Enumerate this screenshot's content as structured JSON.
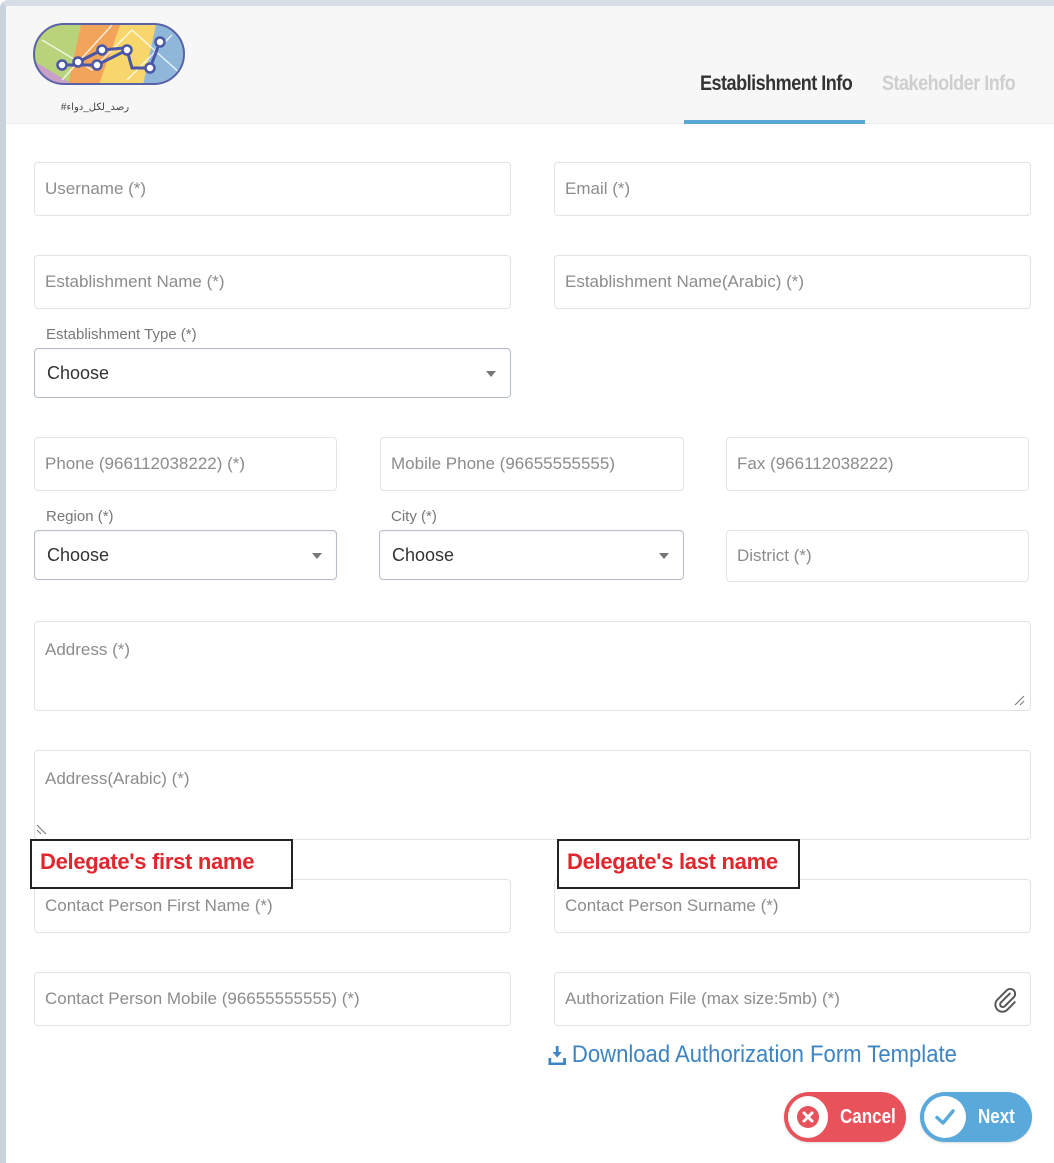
{
  "logo": {
    "caption": "#رصد_لكل_دواء"
  },
  "tabs": {
    "active": "Establishment Info",
    "inactive": "Stakeholder Info"
  },
  "form": {
    "username": "Username (*)",
    "email": "Email (*)",
    "establishment_name": "Establishment Name (*)",
    "establishment_name_arabic": "Establishment Name(Arabic) (*)",
    "establishment_type_label": "Establishment Type (*)",
    "establishment_type_value": "Choose",
    "phone": "Phone (966112038222) (*)",
    "mobile_phone": "Mobile Phone (96655555555)",
    "fax": "Fax (966112038222)",
    "region_label": "Region (*)",
    "region_value": "Choose",
    "city_label": "City (*)",
    "city_value": "Choose",
    "district": "District (*)",
    "address": "Address (*)",
    "address_arabic": "Address(Arabic) (*)",
    "contact_first_name": "Contact Person First Name (*)",
    "contact_surname": "Contact Person Surname (*)",
    "contact_mobile": "Contact Person Mobile (96655555555) (*)",
    "authorization_file": "Authorization File (max size:5mb) (*)"
  },
  "annotations": {
    "first_name_note": "Delegate's first name",
    "last_name_note": "Delegate's last name"
  },
  "download_link": "Download Authorization Form Template",
  "buttons": {
    "cancel": "Cancel",
    "next": "Next"
  },
  "colors": {
    "accent": "#59a7d3",
    "cancel": "#e8525a",
    "next": "#59a9db",
    "annotation": "#e1262d"
  }
}
